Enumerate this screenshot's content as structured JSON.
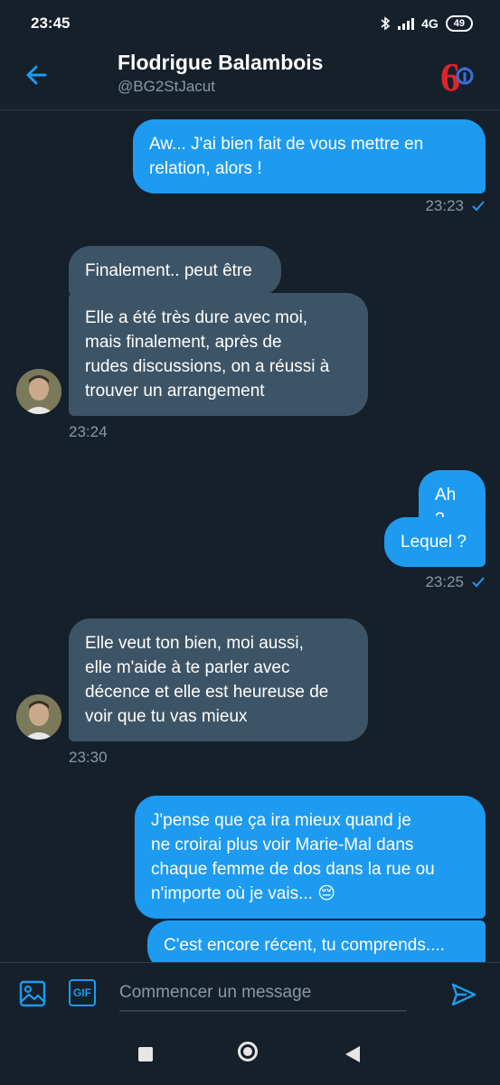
{
  "status": {
    "time": "23:45",
    "network": "4G",
    "battery": "49"
  },
  "header": {
    "name": "Flodrigue Balambois",
    "handle": "@BG2StJacut"
  },
  "messages": [
    {
      "dir": "out",
      "lines": [
        "Aw... J'ai bien fait de vous mettre en",
        "relation, alors !"
      ]
    },
    {
      "dir": "in",
      "lines": [
        "Finalement.. peut être"
      ]
    },
    {
      "dir": "in",
      "lines": [
        "Elle a été très dure avec moi,",
        "mais finalement, après de",
        "rudes discussions, on a réussi à",
        "trouver un arrangement"
      ]
    },
    {
      "dir": "out",
      "lines": [
        "Ah ?"
      ]
    },
    {
      "dir": "out",
      "lines": [
        "Lequel ?"
      ]
    },
    {
      "dir": "in",
      "lines": [
        "Elle veut ton bien, moi aussi,",
        "elle m'aide à te parler avec",
        "décence et elle est heureuse de",
        "voir que tu vas mieux"
      ]
    },
    {
      "dir": "out",
      "lines": [
        "J'pense que ça ira mieux quand je",
        "ne croirai plus voir Marie-Mal dans",
        "chaque femme de dos dans la rue ou",
        "n'importe où je vais... 😔"
      ]
    },
    {
      "dir": "out",
      "lines": [
        "C'est encore récent, tu comprends...."
      ]
    }
  ],
  "timestamps": {
    "t1": "23:23",
    "t2": "23:24",
    "t3": "23:25",
    "t4": "23:30"
  },
  "composer": {
    "placeholder": "Commencer un message",
    "gif_label": "GIF"
  },
  "colors": {
    "background": "#15202b",
    "outgoing_bubble": "#1d9bf0",
    "incoming_bubble": "#3d5466",
    "muted_text": "#8899a6",
    "accent": "#1d9bf0"
  },
  "icons": [
    "back-arrow-icon",
    "logo-icon",
    "read-check-icon",
    "image-icon",
    "gif-icon",
    "send-icon",
    "nav-square-icon",
    "nav-circle-icon",
    "nav-triangle-icon",
    "bluetooth-icon",
    "signal-icon",
    "battery-icon"
  ]
}
